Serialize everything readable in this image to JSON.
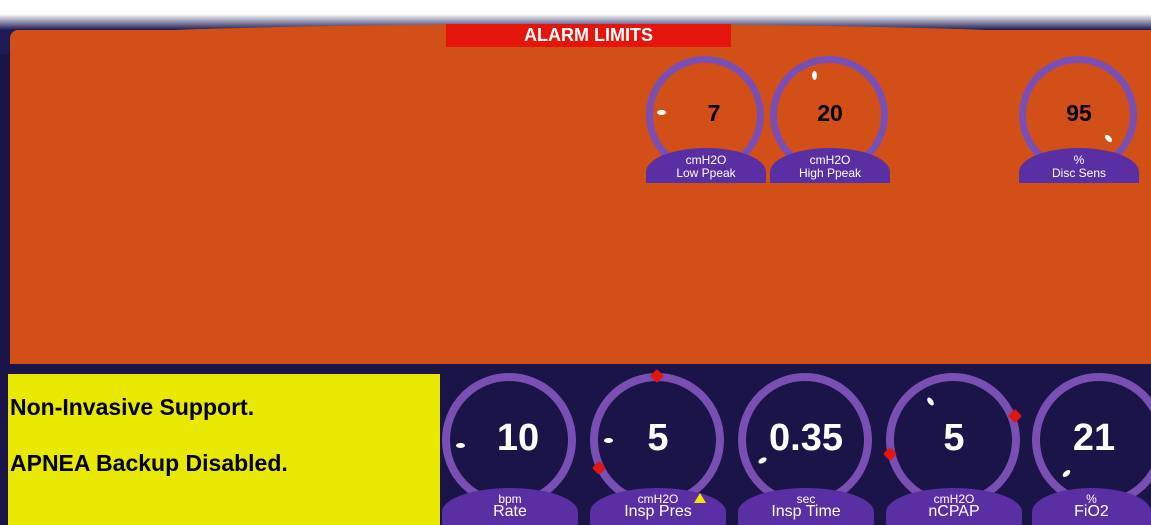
{
  "alarm_panel": {
    "title": "ALARM LIMITS",
    "background": "#d24f17",
    "knobs": [
      {
        "id": "low-ppeak",
        "value": "7",
        "unit": "cmH2O",
        "label": "Low Ppeak"
      },
      {
        "id": "high-ppeak",
        "value": "20",
        "unit": "cmH2O",
        "label": "High Ppeak"
      },
      {
        "id": "disc-sens",
        "value": "95",
        "unit": "%",
        "label": "Disc Sens"
      }
    ]
  },
  "status": {
    "line1": "Non-Invasive Support.",
    "line2": "APNEA Backup Disabled.",
    "background": "#e8e800"
  },
  "settings": [
    {
      "id": "rate",
      "value": "10",
      "unit": "bpm",
      "label": "Rate"
    },
    {
      "id": "insp-pres",
      "value": "5",
      "unit": "cmH2O",
      "label": "Insp Pres",
      "warning_icon": "warning-triangle-icon"
    },
    {
      "id": "insp-time",
      "value": "0.35",
      "unit": "sec",
      "label": "Insp Time"
    },
    {
      "id": "ncpap",
      "value": "5",
      "unit": "cmH2O",
      "label": "nCPAP"
    },
    {
      "id": "fio2",
      "value": "21",
      "unit": "%",
      "label": "FiO2"
    }
  ],
  "colors": {
    "alarm_title_bg": "#e3150c",
    "ring": "#7a4fb4",
    "label_tab": "#5a2fa3",
    "screen_bg": "#1a1448"
  }
}
